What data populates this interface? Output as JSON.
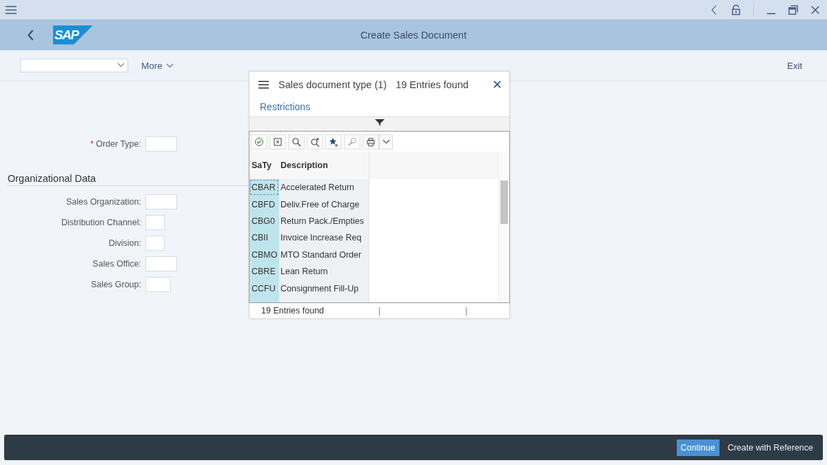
{
  "shell": {
    "logo": "SAP",
    "title": "Create Sales Document"
  },
  "toolbar": {
    "more": "More",
    "exit": "Exit"
  },
  "form": {
    "order_type": {
      "label": "Order Type:",
      "required_mark": "*"
    },
    "section_title": "Organizational Data",
    "fields": [
      {
        "label": "Sales Organization:",
        "kind": "wide"
      },
      {
        "label": "Distribution Channel:",
        "kind": "narrow"
      },
      {
        "label": "Division:",
        "kind": "narrow"
      },
      {
        "label": "Sales Office:",
        "kind": "wide"
      },
      {
        "label": "Sales Group:",
        "kind": "medium"
      }
    ]
  },
  "dialog": {
    "title": "Sales document type (1)",
    "count": "19 Entries found",
    "restrictions": "Restrictions",
    "columns": [
      "SaTy",
      "Description"
    ],
    "rows": [
      {
        "code": "CBAR",
        "description": "Accelerated Return",
        "focused": true
      },
      {
        "code": "CBFD",
        "description": "Deliv.Free of Charge",
        "focused": false
      },
      {
        "code": "CBG0",
        "description": "Return Pack./Empties",
        "focused": false
      },
      {
        "code": "CBII",
        "description": "Invoice Increase Req",
        "focused": false
      },
      {
        "code": "CBMO",
        "description": "MTO Standard Order",
        "focused": false
      },
      {
        "code": "CBRE",
        "description": "Lean Return",
        "focused": false
      },
      {
        "code": "CCFU",
        "description": "Consignment Fill-Up",
        "focused": false
      }
    ],
    "status": "19 Entries found"
  },
  "footer": {
    "buttons": [
      {
        "label": "Continue",
        "kind": "primary"
      },
      {
        "label": "Create with Reference",
        "kind": "plain"
      }
    ]
  }
}
